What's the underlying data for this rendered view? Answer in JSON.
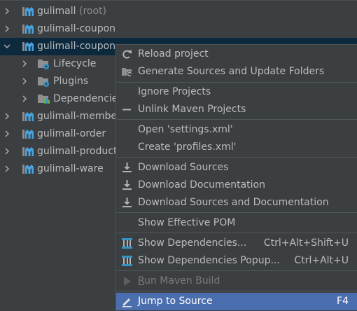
{
  "tree": {
    "items": [
      {
        "name": "gulimall",
        "suffix": "(root)",
        "expanded": false
      },
      {
        "name": "gulimall-coupon",
        "expanded": false
      },
      {
        "name": "gulimall-coupon",
        "expanded": true,
        "selected": true
      },
      {
        "name": "Lifecycle",
        "expanded": false
      },
      {
        "name": "Plugins",
        "expanded": false
      },
      {
        "name": "Dependencies",
        "expanded": false
      },
      {
        "name": "gulimall-member",
        "expanded": false
      },
      {
        "name": "gulimall-order",
        "expanded": false
      },
      {
        "name": "gulimall-product",
        "expanded": false
      },
      {
        "name": "gulimall-ware",
        "expanded": false
      }
    ]
  },
  "menu": {
    "items": [
      {
        "label": "Reload project",
        "icon": "reload-icon"
      },
      {
        "label": "Generate Sources and Update Folders",
        "icon": "generate-sources-icon"
      },
      {
        "label": "Ignore Projects"
      },
      {
        "label": "Unlink Maven Projects",
        "icon": "unlink-icon"
      },
      {
        "label": "Open 'settings.xml'"
      },
      {
        "label": "Create 'profiles.xml'"
      },
      {
        "label": "Download Sources",
        "icon": "download-icon"
      },
      {
        "label": "Download Documentation",
        "icon": "download-icon"
      },
      {
        "label": "Download Sources and Documentation",
        "icon": "download-icon"
      },
      {
        "label": "Show Effective POM"
      },
      {
        "label": "Show Dependencies...",
        "shortcut": "Ctrl+Alt+Shift+U",
        "icon": "dependencies-icon"
      },
      {
        "label": "Show Dependencies Popup...",
        "shortcut": "Ctrl+Alt+U",
        "icon": "dependencies-icon"
      },
      {
        "label": "Run Maven Build",
        "icon": "run-icon",
        "disabled": true
      },
      {
        "label": "Jump to Source",
        "shortcut": "F4",
        "icon": "edit-icon",
        "highlighted": true
      }
    ]
  },
  "colors": {
    "background": "#3c3f41",
    "text": "#bbbbbb",
    "selection": "#0d293e",
    "menu_highlight": "#4b6eaf",
    "maven_blue": "#4aa3df",
    "gear_blue": "#3592c4"
  }
}
